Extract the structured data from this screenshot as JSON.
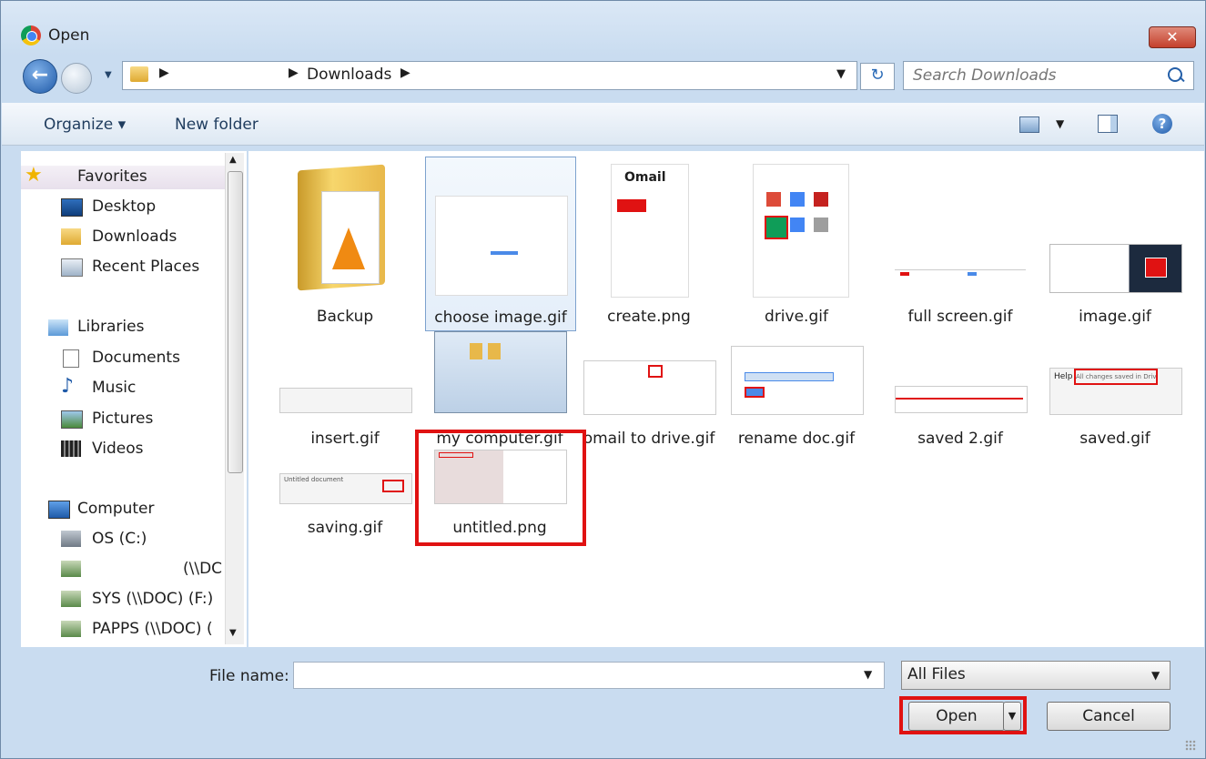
{
  "window": {
    "title": "Open",
    "close_label": "✕"
  },
  "nav": {
    "back_glyph": "←"
  },
  "address": {
    "current": "Downloads"
  },
  "search": {
    "placeholder": "Search Downloads"
  },
  "commands": {
    "organize": "Organize ▾",
    "new_folder": "New folder",
    "help": "?"
  },
  "sidebar": {
    "favorites": [
      "Favorites",
      "Desktop",
      "Downloads",
      "Recent Places"
    ],
    "libraries": [
      "Libraries",
      "Documents",
      "Music",
      "Pictures",
      "Videos"
    ],
    "computer": [
      "Computer",
      "OS (C:)",
      "(\\\\DC",
      "SYS (\\\\DOC) (F:)",
      "PAPPS (\\\\DOC) ("
    ]
  },
  "files": [
    {
      "name": "Backup",
      "kind": "folder"
    },
    {
      "name": "choose image.gif",
      "kind": "image",
      "selected": true
    },
    {
      "name": "create.png",
      "kind": "image"
    },
    {
      "name": "drive.gif",
      "kind": "image"
    },
    {
      "name": "full screen.gif",
      "kind": "image"
    },
    {
      "name": "image.gif",
      "kind": "image"
    },
    {
      "name": "insert.gif",
      "kind": "image"
    },
    {
      "name": "my computer.gif",
      "kind": "image"
    },
    {
      "name": "omail to drive.gif",
      "kind": "image"
    },
    {
      "name": "rename doc.gif",
      "kind": "image"
    },
    {
      "name": "saved 2.gif",
      "kind": "image"
    },
    {
      "name": "saved.gif",
      "kind": "image"
    },
    {
      "name": "saving.gif",
      "kind": "image"
    },
    {
      "name": "untitled.png",
      "kind": "image",
      "highlighted": true
    }
  ],
  "thumb_text": {
    "omail": "Omail",
    "saved_banner": "All changes saved in Drive",
    "help": "Help",
    "doc_title": "Untitled document"
  },
  "footer": {
    "file_name_label": "File name:",
    "file_name_value": "",
    "file_type": "All Files",
    "open": "Open",
    "cancel": "Cancel"
  },
  "colors": {
    "highlight": "#e01212",
    "accent": "#1f5aa8"
  }
}
